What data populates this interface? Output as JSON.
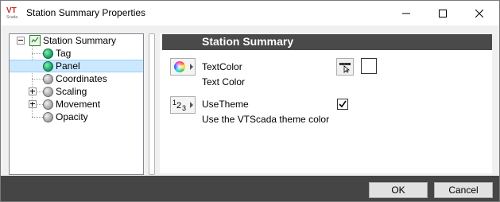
{
  "window": {
    "title": "Station Summary Properties",
    "logo_text_top": "VT",
    "logo_text_bottom": "Scada"
  },
  "tree": {
    "root": "Station Summary",
    "items": [
      {
        "label": "Tag",
        "icon": "green-node-icon",
        "expander": false
      },
      {
        "label": "Panel",
        "icon": "green-node-icon",
        "expander": false,
        "selected": true
      },
      {
        "label": "Coordinates",
        "icon": "gray-node-icon",
        "expander": false
      },
      {
        "label": "Scaling",
        "icon": "gray-node-icon",
        "expander": true
      },
      {
        "label": "Movement",
        "icon": "gray-node-icon",
        "expander": true
      },
      {
        "label": "Opacity",
        "icon": "gray-node-icon",
        "expander": false
      }
    ]
  },
  "properties": {
    "header": "Station Summary",
    "rows": [
      {
        "name": "TextColor",
        "description": "Text Color",
        "type_icon": "color-wheel-icon",
        "value_color": "#ffffff"
      },
      {
        "name": "UseTheme",
        "description": "Use the VTScada theme color",
        "type_icon": "numeric-type-icon",
        "checked": true
      }
    ],
    "numeric_icon_text": "123"
  },
  "buttons": {
    "ok": "OK",
    "cancel": "Cancel"
  },
  "colors": {
    "header_bg": "#4a4a4a",
    "footer_bg": "#454545",
    "selection": "#cce8ff"
  }
}
